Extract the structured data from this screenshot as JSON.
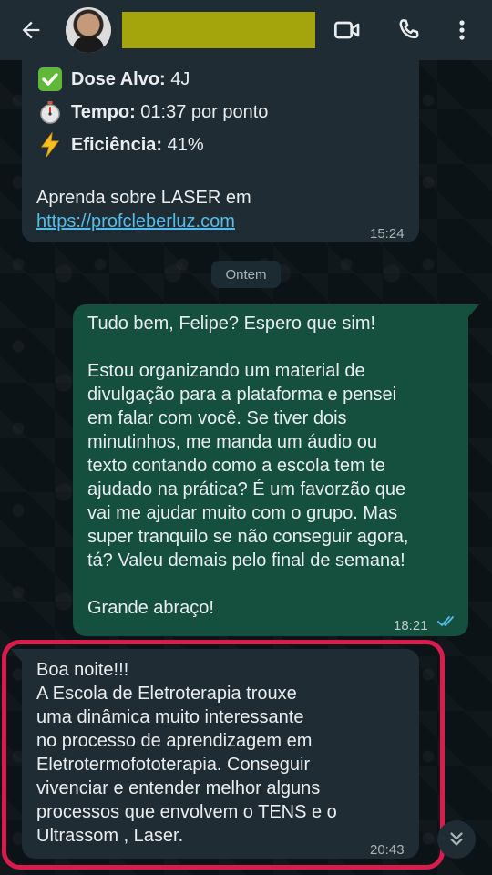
{
  "header": {
    "back_icon": "arrow-left-icon",
    "contact_name_redacted": true,
    "icons": [
      "video-call-icon",
      "phone-icon",
      "more-vert-icon"
    ]
  },
  "messages": [
    {
      "type": "incoming",
      "lines": [
        {
          "icon": "check-box-icon",
          "label": "Dose Alvo:",
          "value": " 4J"
        },
        {
          "icon": "stopwatch-icon",
          "label": "Tempo:",
          "value": " 01:37 por ponto"
        },
        {
          "icon": "lightning-icon",
          "label": "Eficiência:",
          "value": " 41%"
        }
      ],
      "text": "Aprenda sobre LASER em",
      "link": "https://profcleberluz.com",
      "time": "15:24"
    },
    {
      "type": "outgoing",
      "text": "Tudo bem, Felipe? Espero que sim!\n\nEstou organizando um material de\ndivulgação para a plataforma e pensei\nem falar com você. Se tiver dois\nminutinhos, me manda um áudio ou\ntexto contando como a escola tem te\najudado na prática? É um favorzão que\nvai me ajudar muito com o grupo. Mas\nsuper tranquilo se não conseguir agora,\ntá? Valeu demais pelo final de semana!\n\nGrande abraço!",
      "time": "18:21",
      "status": "read"
    },
    {
      "type": "incoming",
      "text": "Boa noite!!!\nA Escola de Eletroterapia trouxe\numa dinâmica muito interessante\nno processo de aprendizagem em\nEletrotermofototerapia. Conseguir\nvivenciar e entender melhor alguns\nprocessos que envolvem o TENS e o\nUltrassom , Laser.",
      "time": "20:43"
    }
  ],
  "date_divider": "Ontem",
  "colors": {
    "header_bg": "#1f2c33",
    "incoming_bg": "#202c33",
    "outgoing_bg": "#15503f",
    "link": "#53bdeb",
    "highlight": "#d91c4d",
    "read_ticks": "#53bdeb"
  }
}
